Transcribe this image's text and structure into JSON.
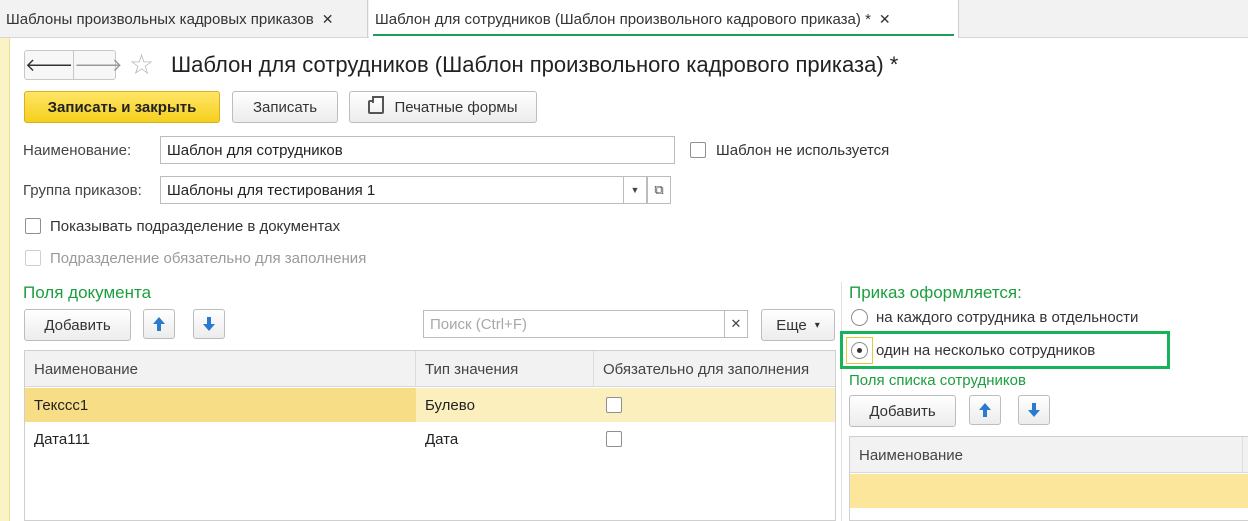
{
  "tabs": [
    {
      "label": "Шаблоны произвольных кадровых приказов",
      "close": "✕"
    },
    {
      "label": "Шаблон для сотрудников (Шаблон произвольного кадрового приказа) *",
      "close": "✕"
    }
  ],
  "header": {
    "back_icon": "arrow-left-icon",
    "forward_icon": "arrow-right-icon",
    "back": "🡐",
    "forward": "🡒",
    "star": "☆",
    "title": "Шаблон для сотрудников (Шаблон произвольного кадрового приказа) *"
  },
  "toolbar": {
    "save_close": "Записать и закрыть",
    "save": "Записать",
    "print_forms": "Печатные формы"
  },
  "form": {
    "name_label": "Наименование:",
    "name_value": "Шаблон для сотрудников",
    "not_used_label": "Шаблон не используется",
    "group_label": "Группа приказов:",
    "group_value": "Шаблоны для тестирования 1",
    "dropdown_glyph": "▼",
    "open_glyph": "⧉",
    "show_division_label": "Показывать подразделение в документах",
    "division_required_label": "Подразделение обязательно для заполнения"
  },
  "doc_fields": {
    "title": "Поля документа",
    "add": "Добавить",
    "search_placeholder": "Поиск (Ctrl+F)",
    "search_clear": "✕",
    "more": "Еще",
    "more_glyph": "▾",
    "columns": [
      "Наименование",
      "Тип значения",
      "Обязательно для заполнения"
    ],
    "rows": [
      {
        "name": "Тексcс1",
        "type": "Булево",
        "required": false
      },
      {
        "name": "Дата111",
        "type": "Дата",
        "required": false
      }
    ]
  },
  "order": {
    "title": "Приказ оформляется:",
    "option_each": "на каждого сотрудника в отдельности",
    "option_one": "один на несколько сотрудников",
    "selected": "option_one",
    "employee_fields_title": "Поля списка сотрудников",
    "add": "Добавить",
    "columns": [
      "Наименование"
    ]
  },
  "colors": {
    "accent_green": "#1c9e3e",
    "primary_button": "#f5cf1e",
    "highlight_box": "#17b35a",
    "selected_row": "#fbefbd",
    "arrow_blue": "#2a7bd0"
  }
}
